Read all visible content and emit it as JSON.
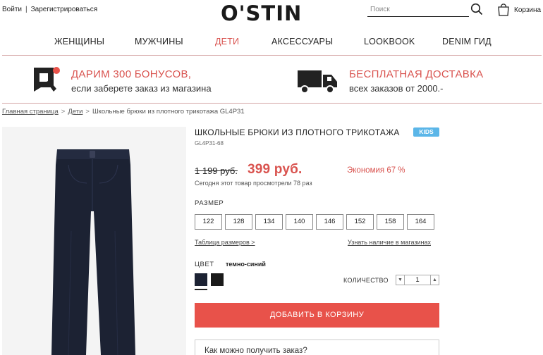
{
  "header": {
    "login": "Войти",
    "separator": "|",
    "register": "Зарегистрироваться",
    "logo": "O'STIN",
    "search_placeholder": "Поиск",
    "cart_label": "Корзина"
  },
  "nav": {
    "items": [
      "ЖЕНЩИНЫ",
      "МУЖЧИНЫ",
      "ДЕТИ",
      "АКСЕССУАРЫ",
      "LOOKBOOK",
      "DENIM ГИД"
    ],
    "active": "ДЕТИ"
  },
  "promo": {
    "bonus_title": "ДАРИМ 300 БОНУСОВ,",
    "bonus_sub": "если заберете заказ из магазина",
    "delivery_title": "БЕСПЛАТНАЯ ДОСТАВКА",
    "delivery_sub": "всех заказов от 2000.-"
  },
  "breadcrumb": {
    "home": "Главная страница",
    "kids": "Дети",
    "current": "Школьные брюки из плотного трикотажа GL4P31",
    "sep": ">"
  },
  "product": {
    "title": "ШКОЛЬНЫЕ БРЮКИ ИЗ ПЛОТНОГО ТРИКОТАЖА",
    "badge": "KIDS",
    "sku": "GL4P31-68",
    "old_price": "1 199 руб.",
    "new_price": "399 руб.",
    "savings": "Экономия 67 %",
    "viewers": "Сегодня этот товар просмотрели 78 раз",
    "size_label": "РАЗМЕР",
    "sizes": [
      "122",
      "128",
      "134",
      "140",
      "146",
      "152",
      "158",
      "164"
    ],
    "size_table_link": "Таблица размеров >",
    "store_link": "Узнать наличие в магазинах",
    "color_label": "ЦВЕТ",
    "color_name": "темно-синий",
    "swatches": [
      "#1c2233",
      "#1a1a1a"
    ],
    "qty_label": "КОЛИЧЕСТВО",
    "qty_value": "1",
    "add_to_cart": "ДОБАВИТЬ В КОРЗИНУ",
    "delivery_question": "Как можно получить заказ?"
  },
  "colors": {
    "accent": "#e8524a",
    "badge": "#5bb6e8"
  }
}
